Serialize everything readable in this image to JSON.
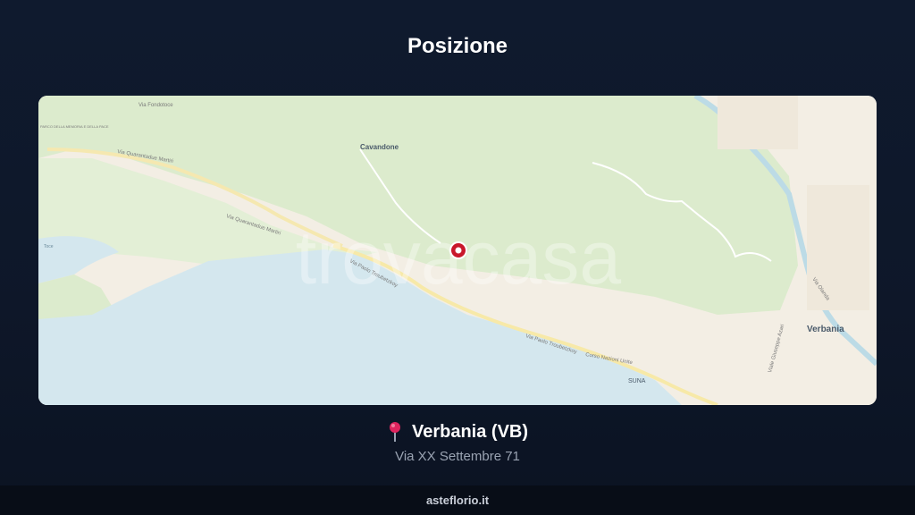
{
  "header": {
    "title": "Posizione"
  },
  "map": {
    "watermark": "trovacasa",
    "labels": {
      "cavandone": "Cavandone",
      "verbania": "Verbania",
      "suna": "SUNA",
      "via_fondotoce": "Via Fondotoce",
      "via_quarantadue_martiri_1": "Via Quarantadue Martiri",
      "via_quarantadue_martiri_2": "Via Quarantadue Martiri",
      "via_troubetzkoy_1": "Via Paolo Troubetzkoy",
      "via_troubetzkoy_2": "Via Paolo Troubetzkoy",
      "corso_nazioni_unite": "Corso Nazioni Unite",
      "viale_azari": "Viale Giuseppe Azari",
      "via_olanda": "Via Olanda",
      "parco": "PARCO DELLA MEMORIA E DELLA PACE",
      "toce": "Toce"
    },
    "colors": {
      "lake": "#d4e7ee",
      "forest": "#dceccd",
      "urban": "#f3eee4",
      "marker": "#c9182b"
    }
  },
  "location": {
    "city": "Verbania (VB)",
    "address": "Via XX Settembre 71",
    "pin_icon": "red-pushpin"
  },
  "footer": {
    "site": "asteflorio.it"
  }
}
